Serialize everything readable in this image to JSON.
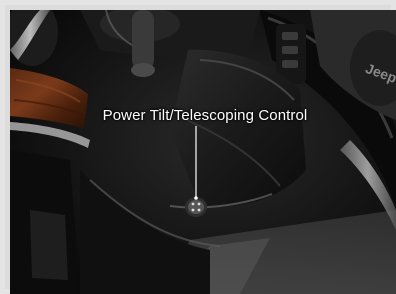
{
  "photo": {
    "callout_label": "Power Tilt/Telescoping Control"
  }
}
